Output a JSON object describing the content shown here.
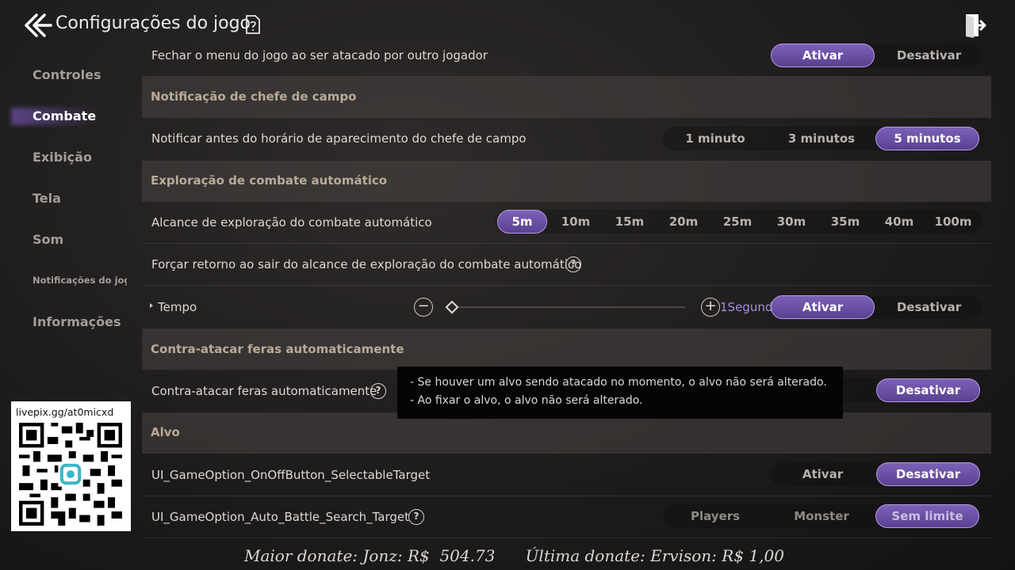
{
  "header": {
    "title": "Configurações do jogo"
  },
  "sidebar": {
    "items": [
      {
        "label": "Controles"
      },
      {
        "label": "Combate"
      },
      {
        "label": "Exibição"
      },
      {
        "label": "Tela"
      },
      {
        "label": "Som"
      },
      {
        "label": "Notificações do jogo"
      },
      {
        "label": "Informações"
      }
    ],
    "active": "Combate"
  },
  "rows": {
    "top_partial": {
      "label": "Fechar o menu do jogo ao ser atacado por outro jogador",
      "on": "Ativar",
      "off": "Desativar",
      "selected": "Ativar"
    },
    "field_boss_section": "Notificação de chefe de campo",
    "field_boss": {
      "label": "Notificar antes do horário de aparecimento do chefe de campo",
      "options": [
        "1 minuto",
        "3 minutos",
        "5 minutos"
      ],
      "selected": "5 minutos"
    },
    "auto_explore_section": "Exploração de combate automático",
    "auto_range": {
      "label": "Alcance de exploração do combate automático",
      "options": [
        "5m",
        "10m",
        "15m",
        "20m",
        "25m",
        "30m",
        "35m",
        "40m",
        "100m"
      ],
      "selected": "5m"
    },
    "force_return": {
      "label": "Forçar retorno ao sair do alcance de exploração do combate automático"
    },
    "tempo": {
      "label": "Tempo",
      "value": "1Segundo",
      "on": "Ativar",
      "off": "Desativar",
      "selected": "Ativar"
    },
    "counter_section": "Contra-atacar feras automaticamente",
    "counter": {
      "label": "Contra-atacar feras automaticamente",
      "off": "Desativar",
      "selected": "Desativar"
    },
    "target_section": "Alvo",
    "selectable_target": {
      "label": "UI_GameOption_OnOffButton_SelectableTarget",
      "on": "Ativar",
      "off": "Desativar",
      "selected": "Desativar"
    },
    "search_target": {
      "label": "UI_GameOption_Auto_Battle_Search_Target",
      "options": [
        "Players",
        "Monster",
        "Sem limite"
      ],
      "selected": "Sem limite"
    }
  },
  "tooltip": {
    "line1": "- Se houver um alvo sendo atacado no momento, o alvo não será alterado.",
    "line2": "- Ao fixar o alvo, o alvo não será alterado."
  },
  "overlay": {
    "qr_caption": "livepix.gg/at0micxd",
    "footer": "Maior donate: Jonz: R$  504.73      Última donate: Ervison: R$ 1,00"
  },
  "colors": {
    "accent": "#7c62b8",
    "accent_border": "#b49ae6",
    "section_title": "#b8ab99"
  },
  "icons": [
    "back-double-chevron-icon",
    "document-icon",
    "exit-door-icon",
    "help-icon",
    "minus-icon",
    "plus-icon"
  ]
}
